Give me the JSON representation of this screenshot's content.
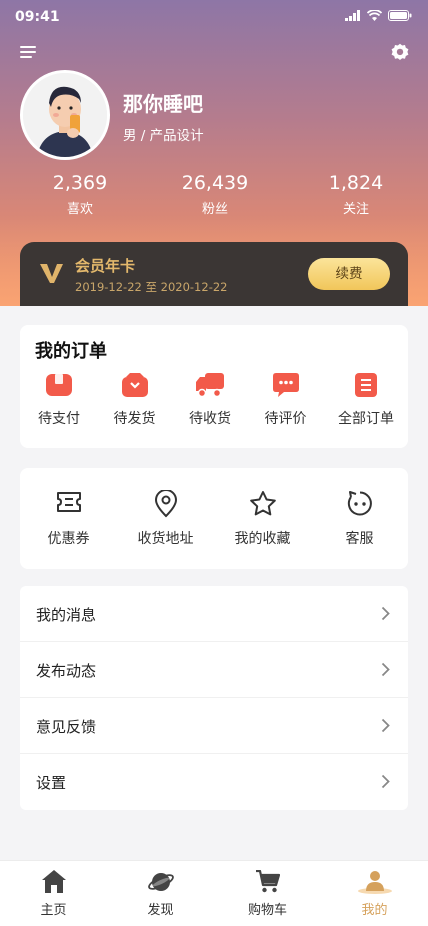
{
  "status_bar": {
    "time": "09:41"
  },
  "profile": {
    "name": "那你睡吧",
    "subtitle": "男 / 产品设计",
    "stats": [
      {
        "value": "2,369",
        "label": "喜欢"
      },
      {
        "value": "26,439",
        "label": "粉丝"
      },
      {
        "value": "1,824",
        "label": "关注"
      }
    ]
  },
  "vip": {
    "title": "会员年卡",
    "date_range": "2019-12-22 至 2020-12-22",
    "renew_label": "续费"
  },
  "orders": {
    "title": "我的订单",
    "items": [
      {
        "label": "待支付",
        "icon": "wallet-icon"
      },
      {
        "label": "待发货",
        "icon": "package-icon"
      },
      {
        "label": "待收货",
        "icon": "truck-icon"
      },
      {
        "label": "待评价",
        "icon": "comment-icon"
      },
      {
        "label": "全部订单",
        "icon": "list-icon"
      }
    ]
  },
  "tools": {
    "items": [
      {
        "label": "优惠券",
        "icon": "coupon-icon"
      },
      {
        "label": "收货地址",
        "icon": "location-pin-icon"
      },
      {
        "label": "我的收藏",
        "icon": "star-icon"
      },
      {
        "label": "客服",
        "icon": "customer-service-icon"
      }
    ]
  },
  "menu": {
    "items": [
      {
        "label": "我的消息"
      },
      {
        "label": "发布动态"
      },
      {
        "label": "意见反馈"
      },
      {
        "label": "设置"
      }
    ]
  },
  "tabbar": {
    "items": [
      {
        "label": "主页",
        "icon": "home-icon"
      },
      {
        "label": "发现",
        "icon": "planet-icon"
      },
      {
        "label": "购物车",
        "icon": "cart-icon"
      },
      {
        "label": "我的",
        "icon": "user-icon"
      }
    ],
    "active_index": 3
  },
  "colors": {
    "accent": "#d5a15c",
    "order_icon": "#f25a4a",
    "vip_bg": "#3b3634",
    "vip_gold": "#e3b86c"
  }
}
